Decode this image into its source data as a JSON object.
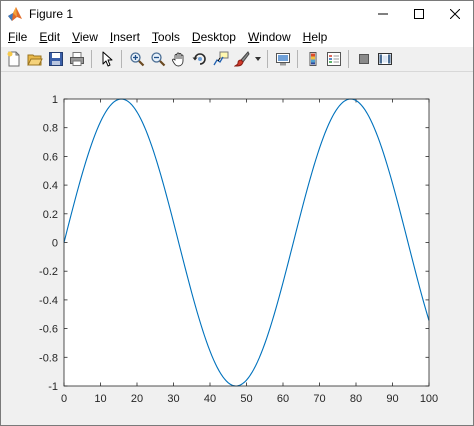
{
  "window": {
    "title": "Figure 1"
  },
  "menu": {
    "items": [
      {
        "pre": "",
        "mn": "F",
        "post": "ile"
      },
      {
        "pre": "",
        "mn": "E",
        "post": "dit"
      },
      {
        "pre": "",
        "mn": "V",
        "post": "iew"
      },
      {
        "pre": "",
        "mn": "I",
        "post": "nsert"
      },
      {
        "pre": "",
        "mn": "T",
        "post": "ools"
      },
      {
        "pre": "",
        "mn": "D",
        "post": "esktop"
      },
      {
        "pre": "",
        "mn": "W",
        "post": "indow"
      },
      {
        "pre": "",
        "mn": "H",
        "post": "elp"
      }
    ]
  },
  "toolbar": {
    "icons": [
      "new-figure-icon",
      "open-file-icon",
      "save-icon",
      "print-icon",
      "edit-plot-arrow-icon",
      "zoom-in-icon",
      "zoom-out-icon",
      "pan-hand-icon",
      "rotate-3d-icon",
      "data-cursor-icon",
      "brush-icon",
      "brush-dropdown-icon",
      "link-plot-icon",
      "colorbar-icon",
      "legend-icon",
      "hide-plot-tools-icon",
      "show-plot-tools-icon"
    ]
  },
  "colors": {
    "line": "#0072bd",
    "axes_bg": "#ffffff",
    "figure_bg": "#f0f0f0",
    "axis": "#262626"
  },
  "chart_data": {
    "type": "line",
    "function": "sin(0.1x)",
    "x_range": [
      0,
      100
    ],
    "ylim": [
      -1,
      1
    ],
    "xlim": [
      0,
      100
    ],
    "x_ticks": [
      0,
      10,
      20,
      30,
      40,
      50,
      60,
      70,
      80,
      90,
      100
    ],
    "y_ticks": [
      -1,
      -0.8,
      -0.6,
      -0.4,
      -0.2,
      0,
      0.2,
      0.4,
      0.6,
      0.8,
      1
    ],
    "x_tick_labels": [
      "0",
      "10",
      "20",
      "30",
      "40",
      "50",
      "60",
      "70",
      "80",
      "90",
      "100"
    ],
    "y_tick_labels": [
      "-1",
      "-0.8",
      "-0.6",
      "-0.4",
      "-0.2",
      "0",
      "0.2",
      "0.4",
      "0.6",
      "0.8",
      "1"
    ],
    "series": [
      {
        "values_expr": "sin(x/10)",
        "samples": 201
      }
    ],
    "grid": false,
    "title": "",
    "xlabel": "",
    "ylabel": ""
  }
}
